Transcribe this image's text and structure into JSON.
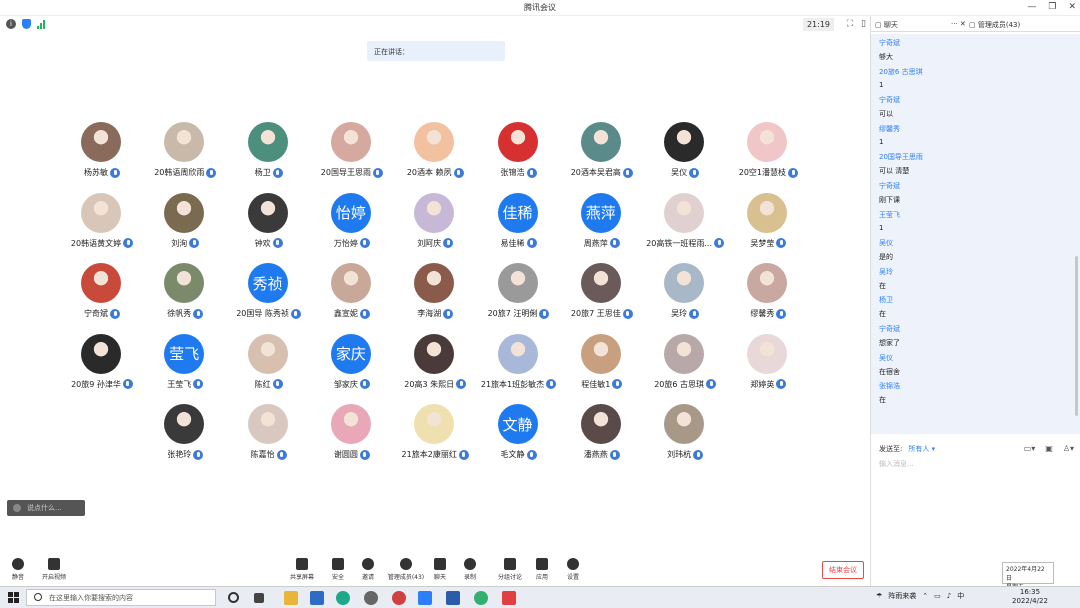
{
  "window": {
    "title": "腾讯会议",
    "timer": "21:19"
  },
  "speaking_label": "正在讲话：",
  "participants": [
    {
      "name": "杨苏敏",
      "avatar": "photo",
      "color": "#8a6a5a"
    },
    {
      "name": "20韩语周欣雨",
      "avatar": "photo",
      "color": "#c9b9a9"
    },
    {
      "name": "杨卫",
      "avatar": "photo",
      "color": "#4b8f7c"
    },
    {
      "name": "20国导王思雨",
      "avatar": "photo",
      "color": "#d6a9a0"
    },
    {
      "name": "20酒本 赖夙",
      "avatar": "photo",
      "color": "#f2c2a0"
    },
    {
      "name": "张锦浩",
      "avatar": "photo",
      "color": "#d63030"
    },
    {
      "name": "20酒本吴君高",
      "avatar": "photo",
      "color": "#5a8a8a"
    },
    {
      "name": "吴仪",
      "avatar": "photo",
      "color": "#2a2a2a"
    },
    {
      "name": "20空1潘慧枝",
      "avatar": "photo",
      "color": "#f0c6c8"
    },
    {
      "name": "20韩语黄文婷",
      "avatar": "photo",
      "color": "#d8c7b8"
    },
    {
      "name": "刘洵",
      "avatar": "photo",
      "color": "#7a6a50"
    },
    {
      "name": "钟欢",
      "avatar": "photo",
      "color": "#3a3a3a"
    },
    {
      "name": "万怡婷",
      "avatar": "text",
      "initials": "怡婷"
    },
    {
      "name": "刘阿庆",
      "avatar": "photo",
      "color": "#c8b8d8"
    },
    {
      "name": "易佳稀",
      "avatar": "text",
      "initials": "佳稀"
    },
    {
      "name": "周燕萍",
      "avatar": "text",
      "initials": "燕萍"
    },
    {
      "name": "20高铁一班程雨...",
      "avatar": "photo",
      "color": "#e0d0d0"
    },
    {
      "name": "吴梦莹",
      "avatar": "photo",
      "color": "#d8c090"
    },
    {
      "name": "宁奇斌",
      "avatar": "photo",
      "color": "#c84a3a"
    },
    {
      "name": "徐帆秀",
      "avatar": "photo",
      "color": "#7a8a6a"
    },
    {
      "name": "20国导 陈秀祯",
      "avatar": "text",
      "initials": "秀祯"
    },
    {
      "name": "鑫宣妮",
      "avatar": "photo",
      "color": "#c8a898"
    },
    {
      "name": "李海湖",
      "avatar": "photo",
      "color": "#8a5a4a"
    },
    {
      "name": "20旅7 汪明俐",
      "avatar": "photo",
      "color": "#9a9a9a"
    },
    {
      "name": "20旅7 王思佳",
      "avatar": "photo",
      "color": "#6a5a5a"
    },
    {
      "name": "吴玲",
      "avatar": "photo",
      "color": "#a8b8c8"
    },
    {
      "name": "缪馨秀",
      "avatar": "photo",
      "color": "#c8a8a0"
    },
    {
      "name": "20旅9 孙津华",
      "avatar": "photo",
      "color": "#2a2a2a"
    },
    {
      "name": "王莹飞",
      "avatar": "text",
      "initials": "莹飞"
    },
    {
      "name": "陈红",
      "avatar": "photo",
      "color": "#d8c0b0"
    },
    {
      "name": "邹家庆",
      "avatar": "text",
      "initials": "家庆"
    },
    {
      "name": "20高3 朱熙日",
      "avatar": "photo",
      "color": "#4a3a3a"
    },
    {
      "name": "21旅本1班彭敏杰",
      "avatar": "photo",
      "color": "#a8b8d8"
    },
    {
      "name": "程佳敏1",
      "avatar": "photo",
      "color": "#c8a080"
    },
    {
      "name": "20旅6 古思琪",
      "avatar": "photo",
      "color": "#b8a8a8"
    },
    {
      "name": "郑婷英",
      "avatar": "photo",
      "color": "#e8d8d8"
    },
    {
      "name": "张艳玲",
      "avatar": "photo",
      "color": "#3a3a3a"
    },
    {
      "name": "陈嘉怡",
      "avatar": "photo",
      "color": "#d8c8c0"
    },
    {
      "name": "谢圆圆",
      "avatar": "photo",
      "color": "#e8a8b8"
    },
    {
      "name": "21旅本2康丽红",
      "avatar": "photo",
      "color": "#f0e0b0"
    },
    {
      "name": "毛文静",
      "avatar": "text",
      "initials": "文静"
    },
    {
      "name": "潘燕燕",
      "avatar": "photo",
      "color": "#5a4a4a"
    },
    {
      "name": "刘玮杭",
      "avatar": "photo",
      "color": "#a89888"
    }
  ],
  "input_hint": "说点什么...",
  "toolbar": {
    "mute": "静音",
    "video": "开启视频",
    "share": "共享屏幕",
    "security": "安全",
    "invite": "邀请",
    "members": "管理成员(43)",
    "chat": "聊天",
    "record": "录制",
    "breakout": "分组讨论",
    "apps": "应用",
    "settings": "设置",
    "end": "结束会议"
  },
  "chat": {
    "tab_chat": "聊天",
    "tab_members": "管理成员(43)",
    "messages": [
      {
        "sender": "宁奇斌",
        "text": "够大"
      },
      {
        "sender": "20旅6 古思琪",
        "text": "1"
      },
      {
        "sender": "宁奇斌",
        "text": "可以"
      },
      {
        "sender": "缪馨秀",
        "text": "1"
      },
      {
        "sender": "20国导王思雨",
        "text": "可以 清楚"
      },
      {
        "sender": "宁奇斌",
        "text": "刚下课"
      },
      {
        "sender": "王莹飞",
        "text": "1"
      },
      {
        "sender": "吴仪",
        "text": "是的"
      },
      {
        "sender": "吴玲",
        "text": "在"
      },
      {
        "sender": "杨卫",
        "text": "在"
      },
      {
        "sender": "宁奇斌",
        "text": "想家了"
      },
      {
        "sender": "吴仪",
        "text": "在宿舍"
      },
      {
        "sender": "张锦浩",
        "text": "在"
      }
    ],
    "send_to_label": "发送至:",
    "send_to_target": "所有人 ▾",
    "placeholder": "输入消息..."
  },
  "tooltip": {
    "date": "2022年4月22日",
    "weekday": "星期五"
  },
  "taskbar": {
    "search_placeholder": "在这里输入你要搜索的内容",
    "weather": "阵雨来袭",
    "ime": "中",
    "time": "16:35",
    "date": "2022/4/22"
  }
}
